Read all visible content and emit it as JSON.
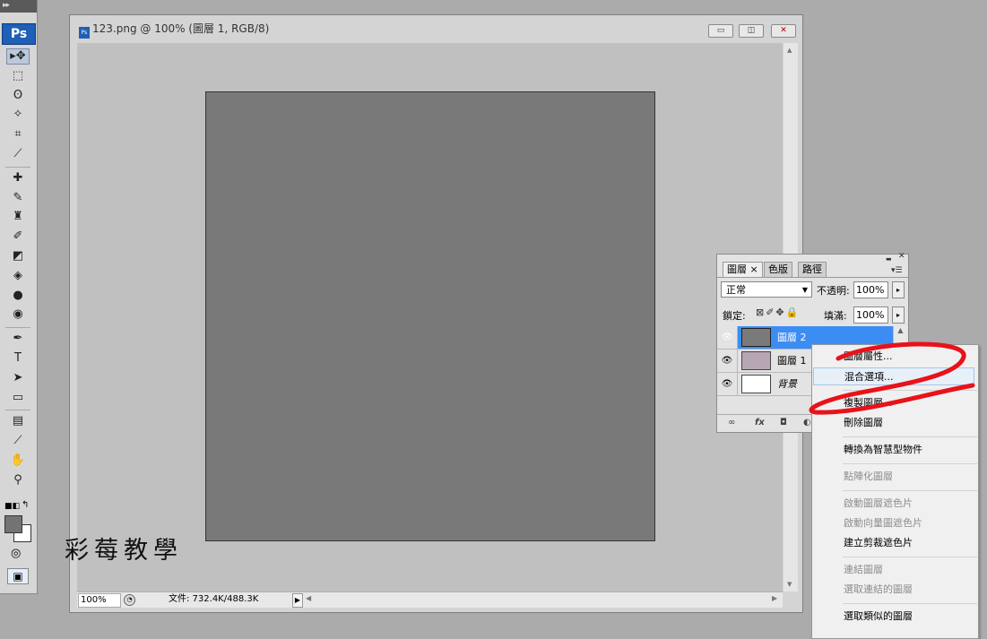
{
  "toolbox": {
    "grip_label": "▸▸",
    "logo": "Ps",
    "tools": [
      {
        "icon": "move-icon",
        "glyph": "▸✥"
      },
      {
        "icon": "marquee-icon",
        "glyph": "⬚"
      },
      {
        "icon": "lasso-icon",
        "glyph": "ʘ"
      },
      {
        "icon": "magic-wand-icon",
        "glyph": "✧"
      },
      {
        "icon": "crop-icon",
        "glyph": "⌗"
      },
      {
        "icon": "eyedropper-slice-icon",
        "glyph": "⟋"
      },
      {
        "icon": "healing-brush-icon",
        "glyph": "✚"
      },
      {
        "icon": "brush-icon",
        "glyph": "✎"
      },
      {
        "icon": "clone-stamp-icon",
        "glyph": "♜"
      },
      {
        "icon": "history-brush-icon",
        "glyph": "✐"
      },
      {
        "icon": "eraser-icon",
        "glyph": "◩"
      },
      {
        "icon": "paint-bucket-icon",
        "glyph": "◈"
      },
      {
        "icon": "blur-icon",
        "glyph": "●"
      },
      {
        "icon": "dodge-icon",
        "glyph": "◉"
      },
      {
        "icon": "pen-icon",
        "glyph": "✒"
      },
      {
        "icon": "type-icon",
        "glyph": "T"
      },
      {
        "icon": "path-selection-icon",
        "glyph": "➤"
      },
      {
        "icon": "shape-icon",
        "glyph": "▭"
      },
      {
        "icon": "notes-icon",
        "glyph": "▤"
      },
      {
        "icon": "eyedropper-icon",
        "glyph": "⟋"
      },
      {
        "icon": "hand-icon",
        "glyph": "✋"
      },
      {
        "icon": "zoom-icon",
        "glyph": "⚲"
      }
    ],
    "quick_mask_glyph": "◎",
    "screen_mode_glyph": "▣"
  },
  "document": {
    "title": "123.png @ 100% (圖層 1, RGB/8)",
    "ps_icon_text": "Ps",
    "minimize": "▭",
    "restore": "◫",
    "close": "✕",
    "zoom_value": "100%",
    "status_text": "文件: 732.4K/488.3K",
    "status_arrow": "▶",
    "scroll_left": "◀",
    "scroll_right": "▶",
    "scroll_up": "▲",
    "scroll_down": "▼"
  },
  "layers_panel": {
    "collapse": "▬",
    "close": "✕",
    "tabs": [
      {
        "label": "圖層",
        "close": "×",
        "active": true
      },
      {
        "label": "色版",
        "active": false
      },
      {
        "label": "路徑",
        "active": false
      }
    ],
    "menu_glyph": "▾☰",
    "blend_mode": "正常",
    "opacity_label": "不透明:",
    "opacity_value": "100%",
    "lock_label": "鎖定:",
    "lock_icons": "⊠✐✥🔒",
    "fill_label": "填滿:",
    "fill_value": "100%",
    "arrow": "▸",
    "layers": [
      {
        "name": "圖層 2",
        "selected": true,
        "thumb": "#7a7a7a"
      },
      {
        "name": "圖層 1",
        "selected": false,
        "thumb": "#b7a6b3"
      },
      {
        "name": "背景",
        "selected": false,
        "thumb": "#ffffff"
      }
    ],
    "eye_glyph": "👁",
    "bottom_icons": {
      "link": "∞",
      "fx": "fx",
      "mask": "◘",
      "adjust": "◐"
    }
  },
  "context_menu": {
    "items": [
      {
        "label": "圖層屬性...",
        "disabled": false,
        "highlight": false
      },
      {
        "label": "混合選項...",
        "disabled": false,
        "highlight": true
      },
      {
        "sep": true
      },
      {
        "label": "複製圖層...",
        "disabled": false,
        "highlight": false
      },
      {
        "label": "刪除圖層",
        "disabled": false,
        "highlight": false
      },
      {
        "sep": true
      },
      {
        "label": "轉換為智慧型物件",
        "disabled": false,
        "highlight": false
      },
      {
        "sep": true
      },
      {
        "label": "點陣化圖層",
        "disabled": true,
        "highlight": false
      },
      {
        "sep": true
      },
      {
        "label": "啟動圖層遮色片",
        "disabled": true,
        "highlight": false
      },
      {
        "label": "啟動向量圖遮色片",
        "disabled": true,
        "highlight": false
      },
      {
        "label": "建立剪裁遮色片",
        "disabled": false,
        "highlight": false
      },
      {
        "sep": true
      },
      {
        "label": "連結圖層",
        "disabled": true,
        "highlight": false
      },
      {
        "label": "選取連結的圖層",
        "disabled": true,
        "highlight": false
      },
      {
        "sep": true
      },
      {
        "label": "選取類似的圖層",
        "disabled": false,
        "highlight": false
      }
    ]
  },
  "watermark": "彩莓教學",
  "colors": {
    "canvas_fill": "#797979",
    "selection": "#3b8df3",
    "scribble": "#e8121a",
    "fg_swatch": "#737373",
    "bg_swatch": "#ffffff"
  }
}
